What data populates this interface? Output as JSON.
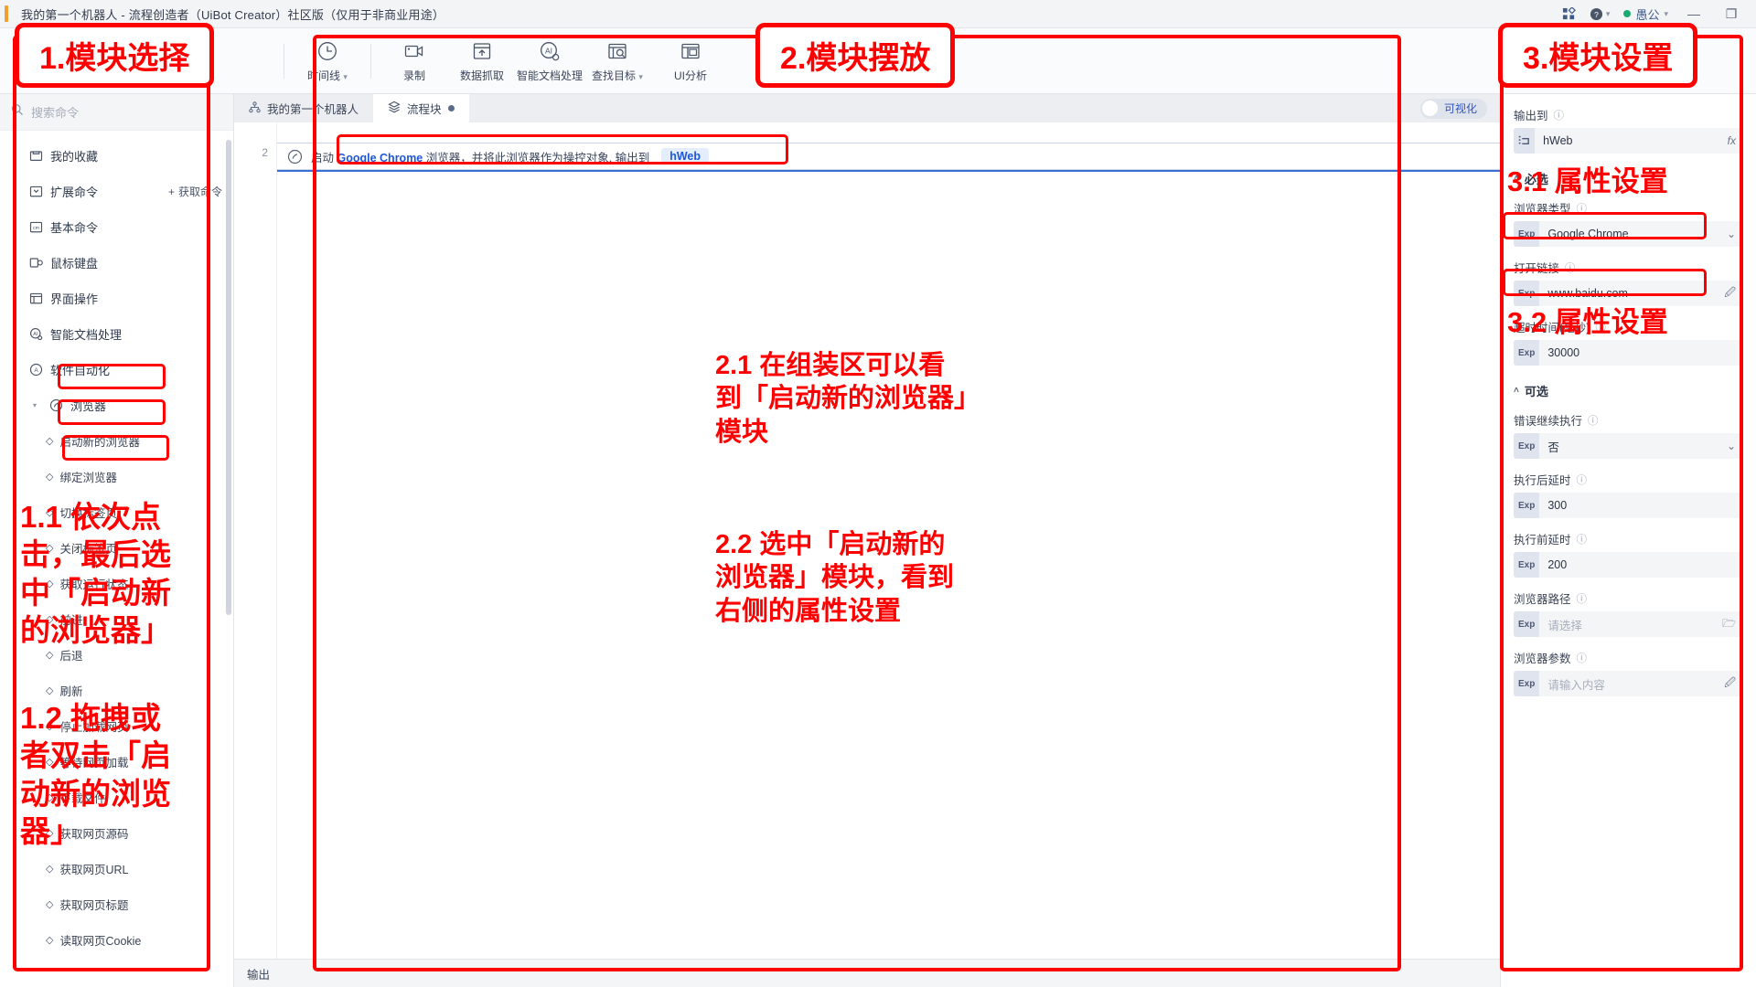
{
  "titlebar": {
    "title": "我的第一个机器人 - 流程创造者（UiBot Creator）社区版（仅用于非商业用途）",
    "user": "愚公",
    "minimize": "—",
    "restore": "❐"
  },
  "toolbar": {
    "items": [
      {
        "label": "时间线",
        "icon": "clock-icon",
        "caret": "▾"
      },
      {
        "label": "录制",
        "icon": "record-camera-icon",
        "caret": ""
      },
      {
        "label": "数据抓取",
        "icon": "data-grab-icon",
        "caret": ""
      },
      {
        "label": "智能文档处理",
        "icon": "ai-doc-icon",
        "caret": ""
      },
      {
        "label": "查找目标",
        "icon": "find-target-icon",
        "caret": "▾"
      },
      {
        "label": "UI分析",
        "icon": "ui-analyze-icon",
        "caret": ""
      }
    ]
  },
  "sidebar": {
    "search_placeholder": "搜索命令",
    "get_command_label": "获取命令",
    "items": [
      {
        "label": "我的收藏",
        "level": 1,
        "arrow": "▸",
        "icon": "folder-star-icon"
      },
      {
        "label": "扩展命令",
        "level": 1,
        "arrow": "▾",
        "icon": "extension-icon",
        "action": "获取命令"
      },
      {
        "label": "基本命令",
        "level": 1,
        "arrow": "▸",
        "icon": "basic-cmd-icon"
      },
      {
        "label": "鼠标键盘",
        "level": 1,
        "arrow": "▸",
        "icon": "mouse-keyboard-icon"
      },
      {
        "label": "界面操作",
        "level": 1,
        "arrow": "▸",
        "icon": "ui-operation-icon"
      },
      {
        "label": "智能文档处理",
        "level": 1,
        "arrow": "▸",
        "icon": "ai-doc-icon"
      },
      {
        "label": "软件自动化",
        "level": 1,
        "arrow": "▾",
        "icon": "automation-icon",
        "highlight": true
      },
      {
        "label": "浏览器",
        "level": 2,
        "arrow": "▾",
        "icon": "browser-icon",
        "highlight": true
      },
      {
        "label": "启动新的浏览器",
        "level": 3,
        "arrow": "◇",
        "selected": true,
        "highlight": true
      },
      {
        "label": "绑定浏览器",
        "level": 3,
        "arrow": "◇"
      },
      {
        "label": "切换标签页",
        "level": 3,
        "arrow": "◇"
      },
      {
        "label": "关闭标签页",
        "level": 3,
        "arrow": "◇"
      },
      {
        "label": "获取运行状态",
        "level": 3,
        "arrow": "◇"
      },
      {
        "label": "前进",
        "level": 3,
        "arrow": "◇"
      },
      {
        "label": "后退",
        "level": 3,
        "arrow": "◇"
      },
      {
        "label": "刷新",
        "level": 3,
        "arrow": "◇"
      },
      {
        "label": "停止加载网页",
        "level": 3,
        "arrow": "◇"
      },
      {
        "label": "等待网页加载",
        "level": 3,
        "arrow": "◇"
      },
      {
        "label": "下载文件",
        "level": 3,
        "arrow": "◇"
      },
      {
        "label": "获取网页源码",
        "level": 3,
        "arrow": "◇"
      },
      {
        "label": "获取网页URL",
        "level": 3,
        "arrow": "◇"
      },
      {
        "label": "获取网页标题",
        "level": 3,
        "arrow": "◇"
      },
      {
        "label": "读取网页Cookie",
        "level": 3,
        "arrow": "◇"
      }
    ]
  },
  "center": {
    "tabs": [
      {
        "label": "我的第一个机器人",
        "icon": "robot-flow-icon",
        "active": false,
        "dirty": false
      },
      {
        "label": "流程块",
        "icon": "layers-icon",
        "active": true,
        "dirty": true
      }
    ],
    "visualize_label": "可视化",
    "line_number": "2",
    "statement": {
      "prefix": "启动",
      "keyword": "Google Chrome",
      "middle": "浏览器，并将此浏览器作为操控对象, 输出到",
      "variable": "hWeb"
    },
    "output_label": "输出"
  },
  "properties": {
    "output_to_label": "输出到",
    "output_to_value": "hWeb",
    "output_to_tag": "var",
    "required_section": "必选",
    "optional_section": "可选",
    "fields": [
      {
        "label": "浏览器类型",
        "tag": "Exp",
        "value": "Google Chrome",
        "control": "dropdown",
        "highlight": true
      },
      {
        "label": "打开链接",
        "tag": "Exp",
        "value": "www.baidu.com",
        "control": "edit",
        "highlight": true
      },
      {
        "label": "超时时间(毫秒)",
        "tag": "Exp",
        "value": "30000",
        "control": "none"
      }
    ],
    "optional_fields": [
      {
        "label": "错误继续执行",
        "tag": "Exp",
        "value": "否",
        "control": "dropdown"
      },
      {
        "label": "执行后延时",
        "tag": "Exp",
        "value": "300",
        "control": "none"
      },
      {
        "label": "执行前延时",
        "tag": "Exp",
        "value": "200",
        "control": "none"
      },
      {
        "label": "浏览器路径",
        "tag": "Exp",
        "value": "请选择",
        "control": "folder",
        "placeholder": true
      },
      {
        "label": "浏览器参数",
        "tag": "Exp",
        "value": "请输入内容",
        "control": "edit",
        "placeholder": true
      }
    ]
  },
  "annotations": {
    "label1": "1.模块选择",
    "label2": "2.模块摆放",
    "label3": "3.模块设置",
    "note_1_1": "1.1 依次点\n击，最后选\n中「启动新\n的浏览器」",
    "note_1_2": "1.2 拖拽或\n者双击「启\n动新的浏览\n器」",
    "note_2_1": "2.1 在组装区可以看\n到「启动新的浏览器」\n模块",
    "note_2_2": "2.2 选中「启动新的\n浏览器」模块，看到\n右侧的属性设置",
    "note_3_1": "3.1 属性设置",
    "note_3_2": "3.2 属性设置",
    "accent_color": "#ff0000"
  }
}
